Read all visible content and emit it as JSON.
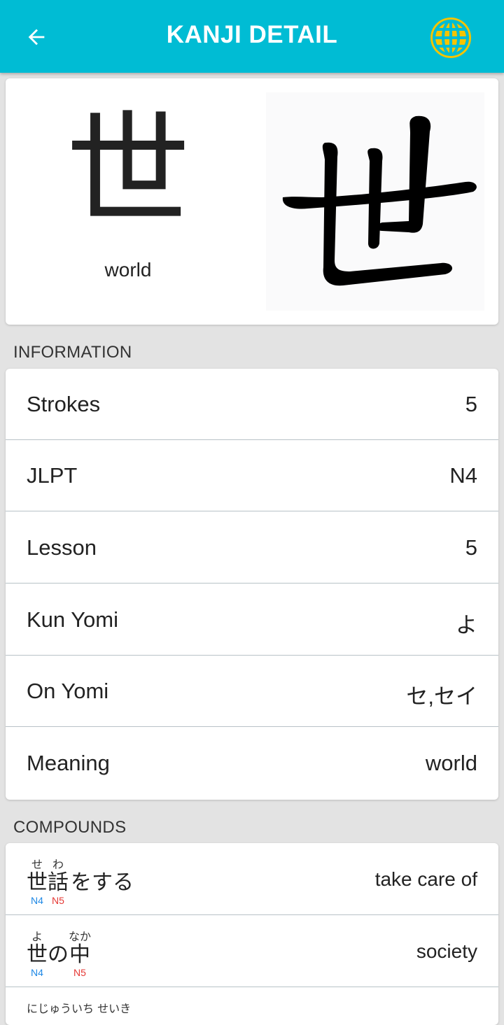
{
  "appbar": {
    "title": "KANJI DETAIL",
    "back_icon": "arrow-back-icon",
    "language_icon": "globe-icon",
    "color": "#00bcd4",
    "icon_accent": "#f5c400"
  },
  "kanji": {
    "character": "世",
    "meaning": "world"
  },
  "information": {
    "header": "INFORMATION",
    "rows": [
      {
        "label": "Strokes",
        "value": "5"
      },
      {
        "label": "JLPT",
        "value": "N4"
      },
      {
        "label": "Lesson",
        "value": "5"
      },
      {
        "label": "Kun Yomi",
        "value": "よ"
      },
      {
        "label": "On Yomi",
        "value": "セ,セイ"
      },
      {
        "label": "Meaning",
        "value": "world"
      }
    ]
  },
  "compounds": {
    "header": "COMPOUNDS",
    "items": [
      {
        "segments": [
          {
            "base": "世",
            "furigana": "せ",
            "level": "N4"
          },
          {
            "base": "話",
            "furigana": "わ",
            "level": "N5"
          },
          {
            "base": "をする",
            "furigana": "",
            "level": ""
          }
        ],
        "meaning": "take care of"
      },
      {
        "segments": [
          {
            "base": "世",
            "furigana": "よ",
            "level": "N4"
          },
          {
            "base": "の",
            "furigana": "",
            "level": ""
          },
          {
            "base": "中",
            "furigana": "なか",
            "level": "N5"
          }
        ],
        "meaning": "society"
      },
      {
        "segments": [
          {
            "base": "",
            "furigana": "にじゅういち せいき",
            "level": ""
          }
        ],
        "meaning": ""
      }
    ]
  }
}
